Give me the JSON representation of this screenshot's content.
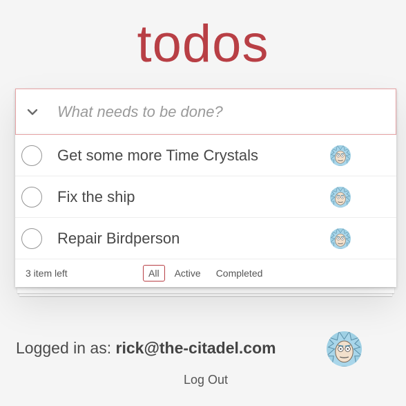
{
  "app": {
    "title": "todos"
  },
  "new_todo": {
    "placeholder": "What needs to be done?",
    "value": ""
  },
  "todos": [
    {
      "label": "Get some more Time Crystals",
      "completed": false,
      "avatar": "rick-avatar-icon"
    },
    {
      "label": "Fix the ship",
      "completed": false,
      "avatar": "rick-avatar-icon"
    },
    {
      "label": "Repair Birdperson",
      "completed": false,
      "avatar": "rick-avatar-icon"
    }
  ],
  "footer": {
    "count": "3 item left",
    "filters": [
      "All",
      "Active",
      "Completed"
    ],
    "selected_filter": "All"
  },
  "session": {
    "prefix": "Logged in as: ",
    "email": "rick@the-citadel.com",
    "logout": "Log Out"
  },
  "colors": {
    "accent": "#b83f45",
    "background": "#f5f5f5"
  }
}
